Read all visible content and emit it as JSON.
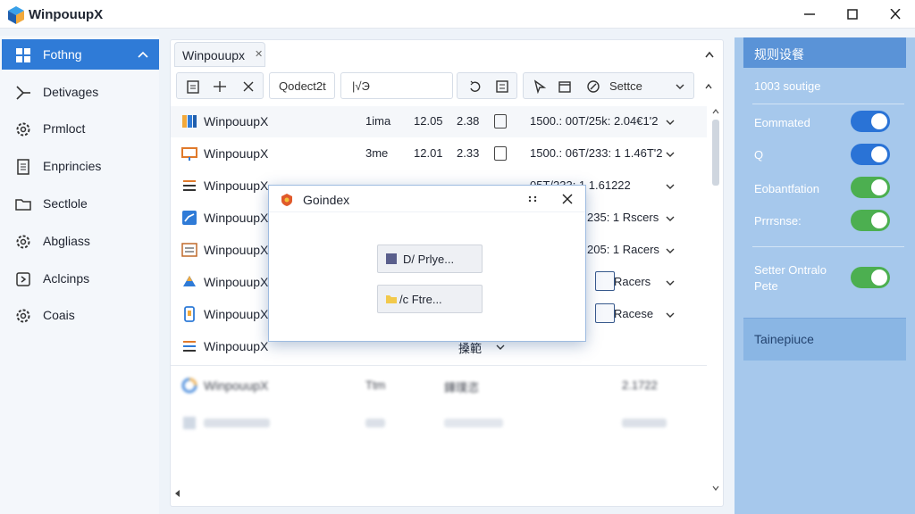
{
  "app": {
    "title": "WinpouupX"
  },
  "sidebar": {
    "items": [
      {
        "label": "Fothng",
        "icon": "grid-icon"
      },
      {
        "label": "Detivages",
        "icon": "branch-icon"
      },
      {
        "label": "Prmloct",
        "icon": "gear-icon"
      },
      {
        "label": "Enprincies",
        "icon": "document-icon"
      },
      {
        "label": "Sectlole",
        "icon": "folder-icon"
      },
      {
        "label": "Abgliass",
        "icon": "gear-icon"
      },
      {
        "label": "Aclcinps",
        "icon": "arrow-box-icon"
      },
      {
        "label": "Coais",
        "icon": "gear-icon"
      }
    ]
  },
  "main": {
    "tab_label": "Winpouupx",
    "toolbar": {
      "search_text": "Qodect2t",
      "field_text": "|√Э",
      "settings_label": "Settce"
    },
    "rows": [
      {
        "name": "WinpouupX",
        "c1": "1ima",
        "c2": "12.05",
        "c3": "2.38",
        "c4": "1500.: 00T/25k: 2.04€1'2"
      },
      {
        "name": "WinpouupX",
        "c1": "3me",
        "c2": "12.01",
        "c3": "2.33",
        "c4": "1500.: 06T/233: 1 1.46T'2"
      },
      {
        "name": "WinpouupX",
        "c4": "05T/233: 1 1.61222"
      },
      {
        "name": "WinpouupX",
        "c4": "235: 1 Rscers"
      },
      {
        "name": "WinpouupX",
        "c4": "205: 1 Racers"
      },
      {
        "name": "WinpouupX",
        "c4": "Racers"
      },
      {
        "name": "WinpouupX",
        "c4": "Racese"
      },
      {
        "name": "WinpouupX",
        "sub": "搡範"
      }
    ],
    "blurred_rows": [
      {
        "name": "WinpouupX",
        "c1": "Ttm",
        "mid": "鏵璞恣",
        "end": "2.1722"
      }
    ]
  },
  "dialog": {
    "title": "Goindex",
    "btn1": "D/ Prlye...",
    "btn2": "/c Ftre..."
  },
  "right_panel": {
    "header": "规则设餐",
    "subtitle": "1003 soutige",
    "toggles": [
      {
        "label": "Eommated",
        "on": true,
        "color": "#2a73d6"
      },
      {
        "label": "Q",
        "on": true,
        "color": "#2a73d6"
      },
      {
        "label": "Eobantfation",
        "on": true,
        "color": "#4caf50"
      },
      {
        "label": "Prrrsnse:",
        "on": true,
        "color": "#4caf50"
      },
      {
        "label": "Setter Ontralo Pete",
        "on": true,
        "color": "#4caf50"
      }
    ],
    "footer": "Tainepiuce"
  }
}
